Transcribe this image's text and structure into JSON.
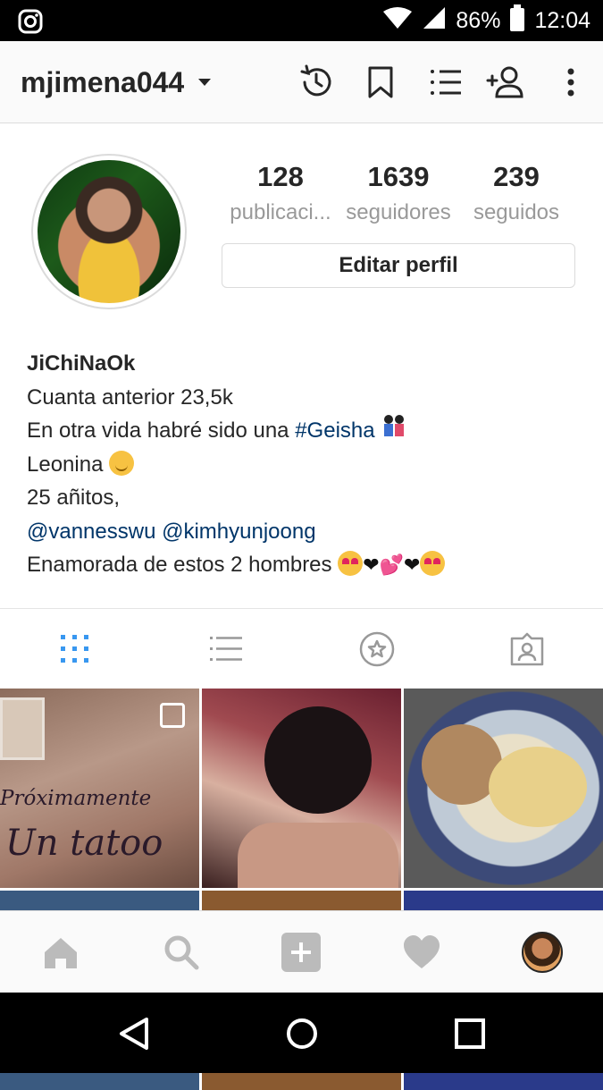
{
  "status_bar": {
    "battery": "86%",
    "time": "12:04",
    "icons": [
      "instagram-icon",
      "wifi-icon",
      "signal-icon",
      "battery-icon"
    ]
  },
  "header": {
    "username": "mjimena044",
    "icons": [
      "history-icon",
      "bookmark-icon",
      "discover-list-icon",
      "add-person-icon",
      "more-vertical-icon"
    ]
  },
  "profile": {
    "stats": [
      {
        "value": "128",
        "label": "publicaci..."
      },
      {
        "value": "1639",
        "label": "seguidores"
      },
      {
        "value": "239",
        "label": "seguidos"
      }
    ],
    "edit_button": "Editar perfil"
  },
  "bio": {
    "name": "JiChiNaOk",
    "line1": "Cuanta anterior 23,5k",
    "line2_text": "En otra vida habré sido una ",
    "line2_tag": "#Geisha",
    "line3": "Leonina",
    "line4": "25 añitos,",
    "line5_mentions": "@vannesswu @kimhyunjoong",
    "line6": "Enamorada de estos 2 hombres"
  },
  "tabs": [
    "grid-view-icon",
    "list-view-icon",
    "saved-star-icon",
    "tagged-photos-icon"
  ],
  "grid": {
    "caption_small": "Próximamente",
    "caption_large": "Un tatoo"
  },
  "bottom_nav": [
    "home-icon",
    "search-icon",
    "new-post-icon",
    "activity-heart-icon",
    "profile-avatar"
  ],
  "system_nav": [
    "back-icon",
    "home-circle-icon",
    "recents-icon"
  ],
  "colors": {
    "link": "#003569",
    "accent": "#3897f0"
  }
}
